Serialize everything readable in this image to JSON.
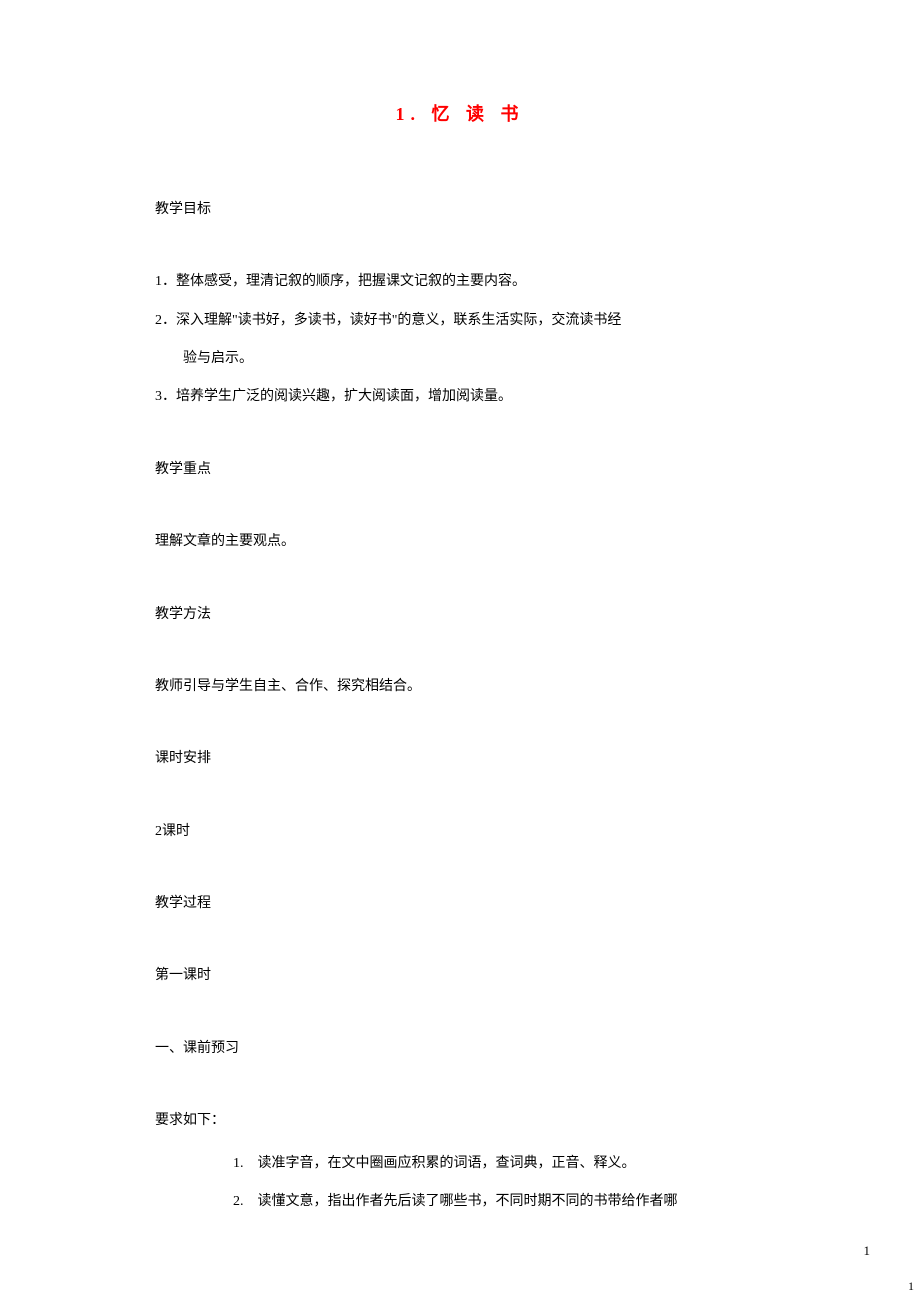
{
  "title": "1. 忆 读 书",
  "headings": {
    "goals": "教学目标",
    "emphasis": "教学重点",
    "method": "教学方法",
    "schedule": "课时安排",
    "process": "教学过程",
    "lesson1": "第一课时",
    "prestudy": "一、课前预习",
    "requirements": "要求如下："
  },
  "goals": {
    "item1": "1．整体感受，理清记叙的顺序，把握课文记叙的主要内容。",
    "item2_line1": "2．深入理解\"读书好，多读书，读好书\"的意义，联系生活实际，交流读书经",
    "item2_line2": "验与启示。",
    "item3": "3．培养学生广泛的阅读兴趣，扩大阅读面，增加阅读量。"
  },
  "emphasis_text": "理解文章的主要观点。",
  "method_text": "教师引导与学生自主、合作、探究相结合。",
  "schedule_text": "2课时",
  "requirements_list": {
    "item1": "1.　读准字音，在文中圈画应积累的词语，查词典，正音、释义。",
    "item2": "2.　读懂文意，指出作者先后读了哪些书，不同时期不同的书带给作者哪"
  },
  "page_number_right": "1",
  "page_number_corner": "1"
}
